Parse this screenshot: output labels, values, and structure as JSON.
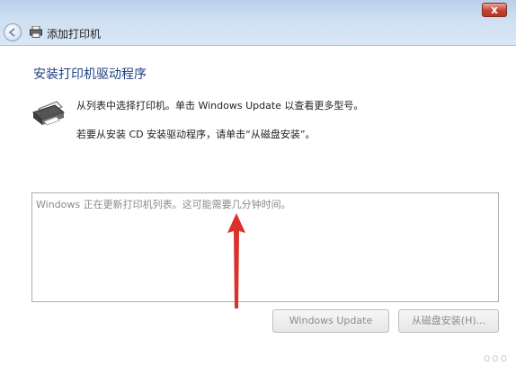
{
  "window": {
    "title": "添加打印机",
    "close_label": "x"
  },
  "page": {
    "heading": "安装打印机驱动程序",
    "instruction_1": "从列表中选择打印机。单击 Windows Update 以查看更多型号。",
    "instruction_2": "若要从安装 CD 安装驱动程序，请单击“从磁盘安装”。"
  },
  "printer_list": {
    "status": "Windows 正在更新打印机列表。这可能需要几分钟时间。"
  },
  "buttons": {
    "windows_update": "Windows Update",
    "have_disk": "从磁盘安装(H)..."
  },
  "colors": {
    "heading": "#1f3f80",
    "arrow": "#d8322a",
    "titlebar": "#cfe0f2"
  },
  "icons": [
    "back-arrow-icon",
    "printer-icon",
    "close-icon",
    "annotation-arrow"
  ],
  "watermark": "ooo"
}
